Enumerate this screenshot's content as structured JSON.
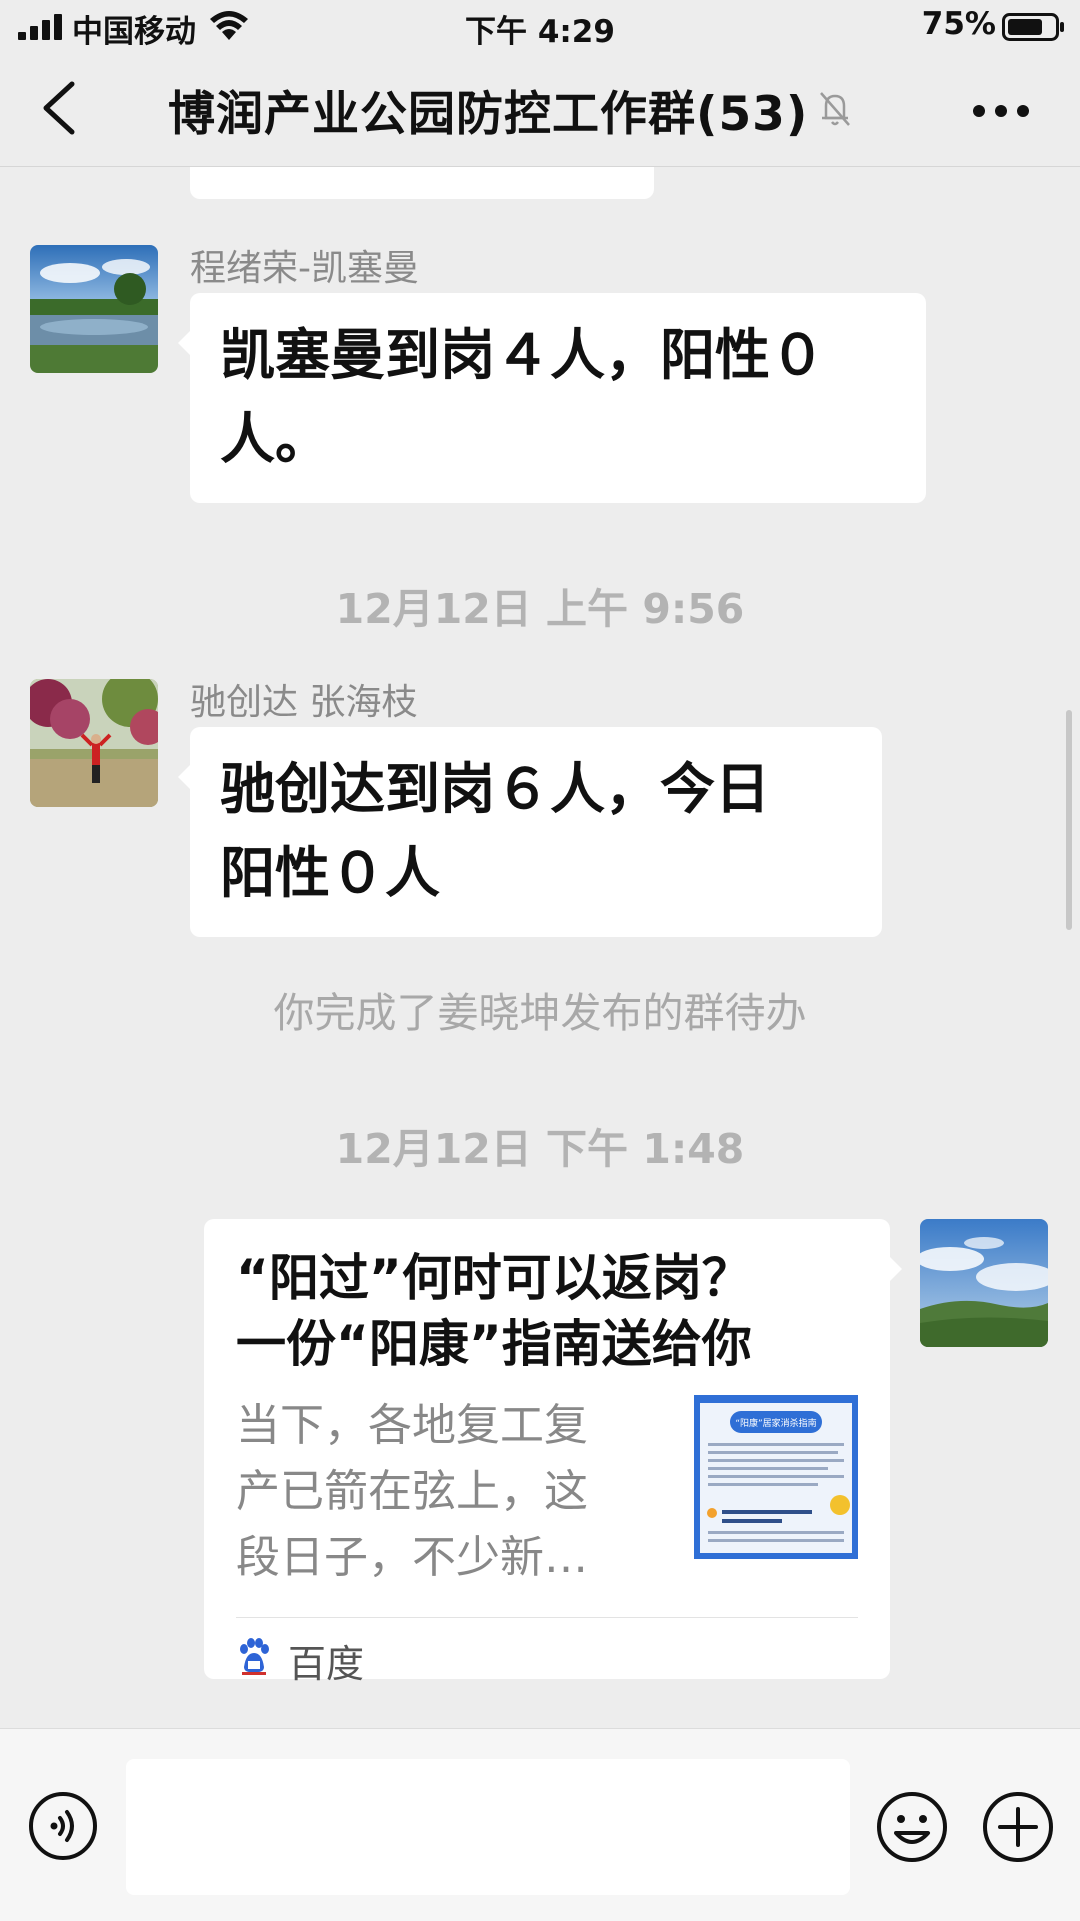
{
  "status_bar": {
    "carrier": "中国移动",
    "time": "下午 4:29",
    "battery_percent": "75%",
    "battery_level": 0.75,
    "icons": [
      "signal-icon",
      "wifi-icon",
      "battery-icon"
    ]
  },
  "nav": {
    "title": "博润产业公园防控工作群(53)",
    "icons": [
      "back-icon",
      "mute-bell-icon",
      "more-icon"
    ]
  },
  "messages": [
    {
      "sender": "程绪荣-凯塞曼",
      "text_line1": "凯塞曼到岗４人，阳性０",
      "text_line2": "人。"
    },
    {
      "timestamp": "12月12日 上午 9:56"
    },
    {
      "sender": "驰创达 张海枝",
      "text_line1": "驰创达到岗６人，今日",
      "text_line2": "阳性０人"
    },
    {
      "system": "你完成了姜晓坤发布的群待办"
    },
    {
      "timestamp": "12月12日 下午 1:48"
    },
    {
      "link_card": {
        "title_line1": "“阳过”何时可以返岗？",
        "title_line2": "一份“阳康”指南送给你",
        "desc_line1": "当下，各地复工复",
        "desc_line2": "产已箭在弦上，这",
        "desc_line3": "段日子，不少新…",
        "source": "百度",
        "thumb_heading": "“阳康”居家消杀指南"
      }
    }
  ],
  "input_bar": {
    "icons": [
      "voice-icon",
      "emoji-icon",
      "plus-icon"
    ]
  }
}
